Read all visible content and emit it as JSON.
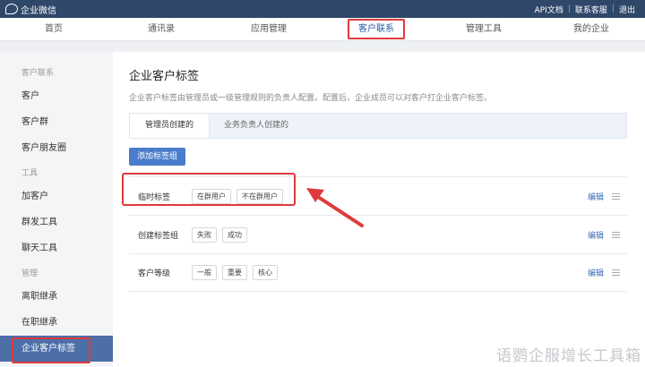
{
  "topbar": {
    "brand": "企业微信",
    "links": [
      "API文档",
      "联系客服",
      "退出"
    ]
  },
  "nav": [
    "首页",
    "通讯录",
    "应用管理",
    "客户联系",
    "管理工具",
    "我的企业"
  ],
  "sidebar": {
    "groups": [
      {
        "title": "客户联系",
        "items": [
          "客户",
          "客户群",
          "客户朋友圈"
        ]
      },
      {
        "title": "工具",
        "items": [
          "加客户",
          "群发工具",
          "聊天工具"
        ]
      },
      {
        "title": "管理",
        "items": [
          "离职继承",
          "在职继承",
          "企业客户标签"
        ]
      }
    ]
  },
  "main": {
    "title": "企业客户标签",
    "desc": "企业客户标签由管理员或一级管理规则的负责人配置。配置后，企业成员可以对客户打企业客户标签。",
    "tabs": [
      "管理员创建的",
      "业务负责人创建的"
    ],
    "add_button": "添加标签组",
    "edit_label": "编辑",
    "tag_groups": [
      {
        "name": "临时标签",
        "tags": [
          "在群用户",
          "不在群用户"
        ]
      },
      {
        "name": "创建标签组",
        "tags": [
          "失败",
          "成功"
        ]
      },
      {
        "name": "客户等级",
        "tags": [
          "一般",
          "重要",
          "核心"
        ]
      }
    ]
  },
  "watermark": "语鹦企服增长工具箱",
  "colors": {
    "topbar": "#2f4769",
    "accent": "#4a7ccc",
    "highlight": "#e0393b"
  }
}
